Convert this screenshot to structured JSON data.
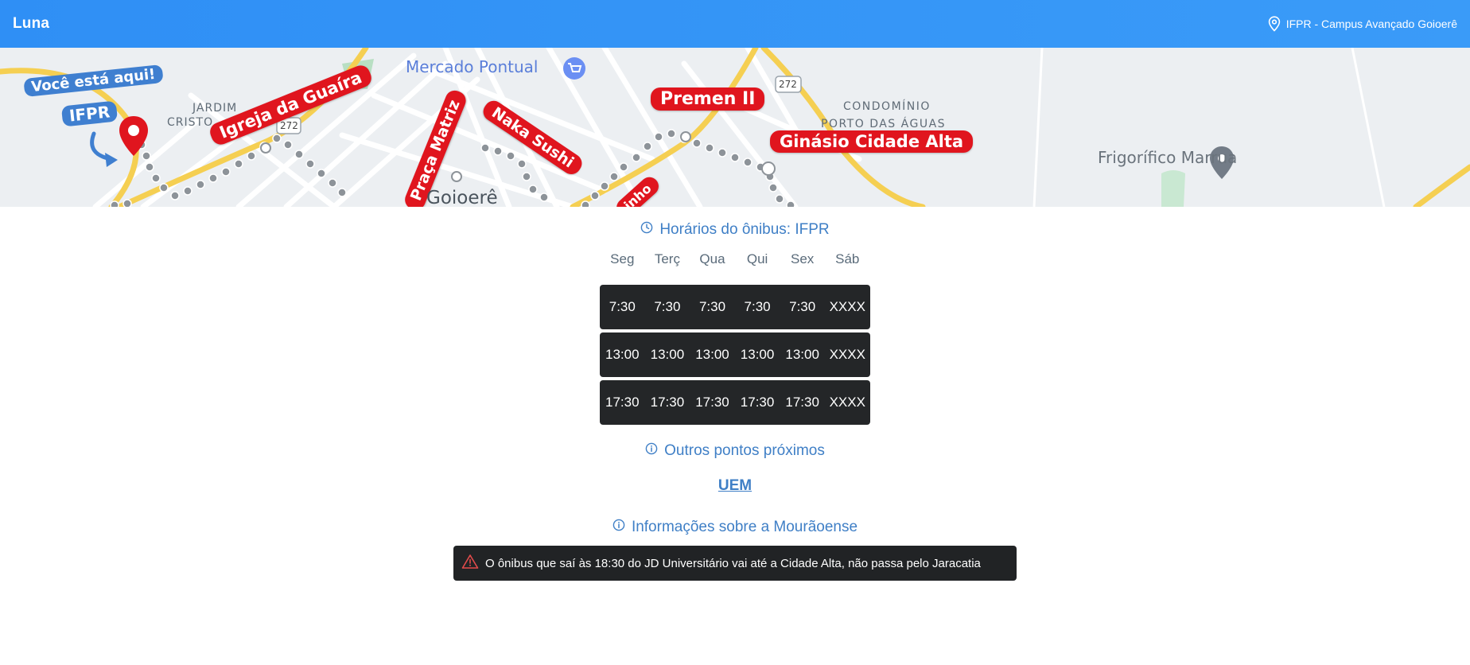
{
  "header": {
    "app_name": "Luna",
    "location_label": "IFPR - Campus Avançado Goioerê",
    "location_icon": "map-pin-icon"
  },
  "map": {
    "you_are_here": "Você está aqui!",
    "current_stop": "IFPR",
    "stop_labels": {
      "igreja": "Igreja da Guaíra",
      "praca": "Praça Matriz",
      "naka": "Naka Sushi",
      "premen": "Premen II",
      "ginasio": "Ginásio Cidade Alta",
      "partial": "inho"
    },
    "place_labels": {
      "mercado": "Mercado Pontual",
      "jardim": "JARDIM",
      "cristo": "CRISTO",
      "goioere": "Goioerê",
      "condominio": "CONDOMÍNIO",
      "porto": "PORTO DAS ÁGUAS",
      "frigorifico": "Frigorífico Marrua",
      "road_272a": "272",
      "road_272b": "272"
    }
  },
  "schedule": {
    "title": "Horários do ônibus: IFPR",
    "title_icon": "clock-icon",
    "days": [
      "Seg",
      "Terç",
      "Qua",
      "Qui",
      "Sex",
      "Sáb"
    ],
    "rows": [
      [
        "7:30",
        "7:30",
        "7:30",
        "7:30",
        "7:30",
        "XXXX"
      ],
      [
        "13:00",
        "13:00",
        "13:00",
        "13:00",
        "13:00",
        "XXXX"
      ],
      [
        "17:30",
        "17:30",
        "17:30",
        "17:30",
        "17:30",
        "XXXX"
      ]
    ]
  },
  "nearby": {
    "title": "Outros pontos próximos",
    "title_icon": "info-icon",
    "stops": [
      "UEM"
    ]
  },
  "info": {
    "title": "Informações sobre a Mourãoense",
    "title_icon": "info-icon",
    "alert_icon": "warning-triangle-icon",
    "alert_text": "O ônibus que saí às 18:30 do JD Universitário vai até a Cidade Alta, não passa pelo Jaracatia"
  },
  "colors": {
    "header": "#3a9bf8",
    "accent": "#3f7fc6",
    "route_label": "#e0151e",
    "dark_row": "#242628",
    "alert_icon": "#e24b4b"
  }
}
